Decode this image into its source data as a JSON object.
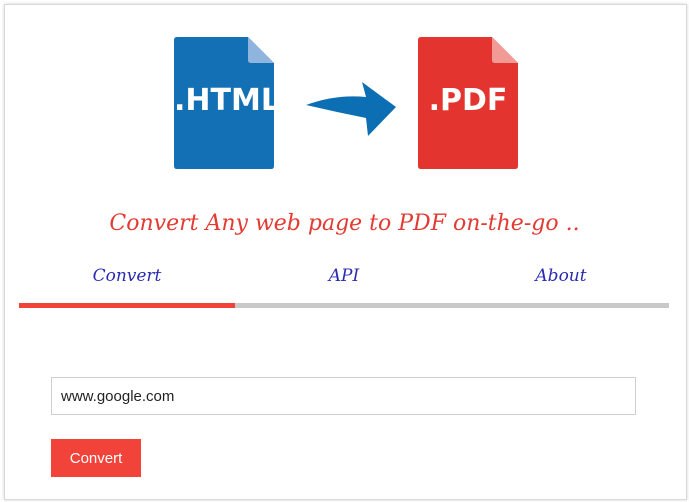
{
  "hero": {
    "source_file_label": ".HTML",
    "target_file_label": ".PDF",
    "source_color": "#1470b5",
    "target_color": "#e3342f",
    "arrow_color": "#0d6fb3",
    "source_icon": "html-file-icon",
    "arrow_icon": "arrow-right-icon",
    "target_icon": "pdf-file-icon"
  },
  "tagline": "Convert Any web page to PDF on-the-go ..",
  "tabs": [
    {
      "label": "Convert",
      "active": true
    },
    {
      "label": "API",
      "active": false
    },
    {
      "label": "About",
      "active": false
    }
  ],
  "form": {
    "url_value": "www.google.com",
    "submit_label": "Convert"
  },
  "colors": {
    "accent": "#f2433a",
    "tab_text": "#2b2bb0",
    "tab_track": "#c9c9c9"
  }
}
